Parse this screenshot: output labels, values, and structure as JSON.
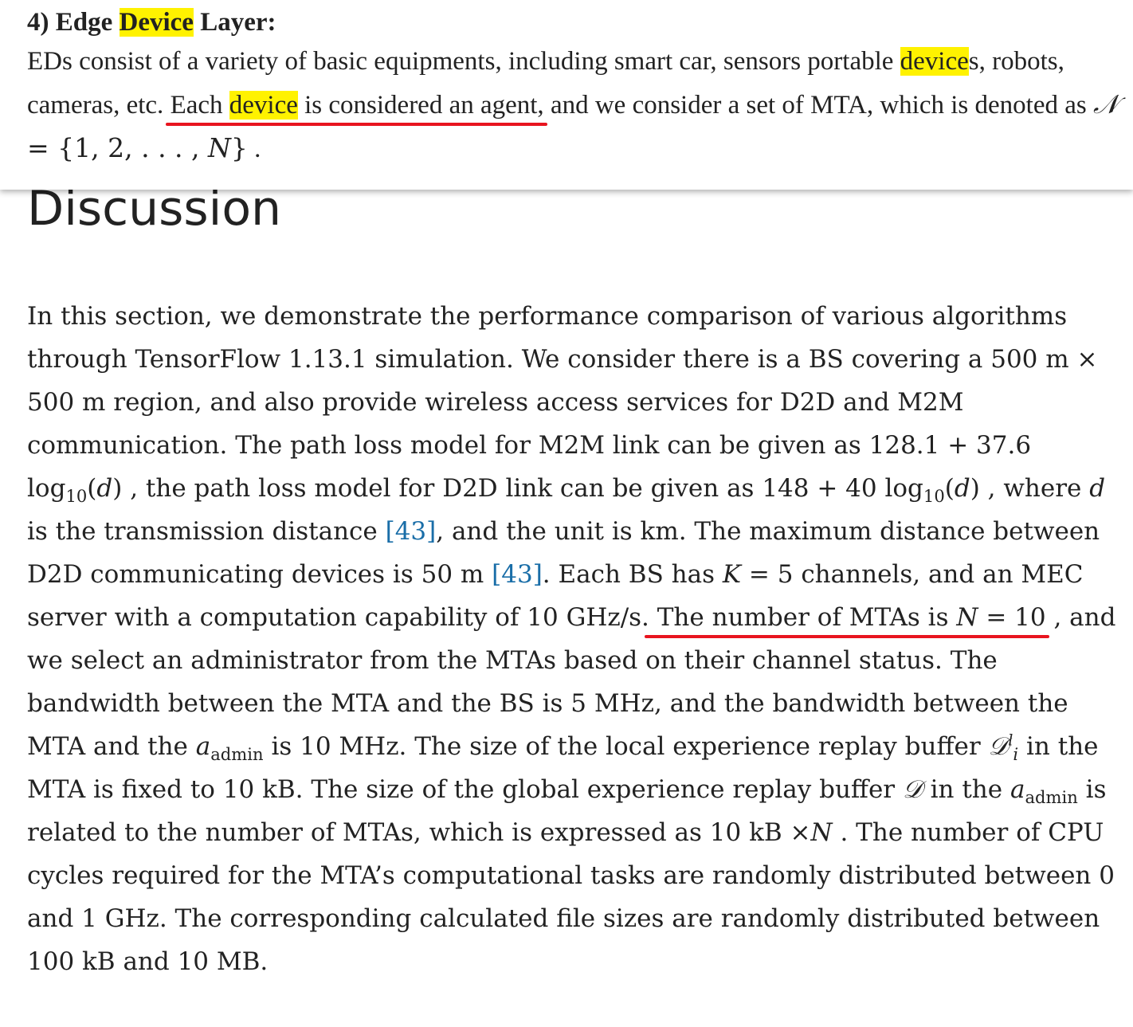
{
  "popup": {
    "title_prefix": "4) Edge ",
    "title_highlight": "Device",
    "title_suffix": " Layer:",
    "body": {
      "s1": "EDs consist of a variety of basic equipments, including smart car, sensors portable ",
      "s2_hl": "device",
      "s3": "s, robots, cameras, etc.",
      "s4_a": "Each ",
      "s4_hl": "device",
      "s4_b": " is considered an agent,",
      "s5": " and we consider a set of MTA, which is denoted as ",
      "s6": "{1, 2, . . . , ",
      "s7": "}",
      "s8": " ."
    }
  },
  "section": {
    "heading": "Discussion",
    "p": {
      "t1": "In this section, we demonstrate the performance comparison of various algorithms through TensorFlow 1.13.1 simulation. We consider there is a BS covering a 500 m ×  500 m region, and also provide wireless access services for D2D and M2M communication. The path loss model for M2M link can be given as ",
      "eq1_a": "128.1 + 37.6 log",
      "eq1_sub": "10",
      "t2": " , the path loss model for D2D link can be given as ",
      "eq2_a": "148 + 40 log",
      "eq2_sub": "10",
      "t3": " , where ",
      "t4": " is the transmission distance ",
      "cite1": "[43]",
      "t5": ", and the unit is km. The maximum distance between D2D communicating devices is 50 m ",
      "cite2": "[43]",
      "t6": ". Each BS has ",
      "eqK": " = 5",
      "t7": " channels, and an MEC server with a computation capability of 10 GHz/s.",
      "u1": " The number of MTAs is ",
      "eqN": " = 10",
      "t8": " , and we select an administrator from the MTAs based on their channel status. The bandwidth between the MTA and the BS is 5 MHz, and the bandwidth between the MTA and the ",
      "admin1": "admin",
      "t9": " is 10 MHz. The size of the local experience replay buffer ",
      "sup_l": "l",
      "sub_i": "i",
      "t10": " in the MTA is fixed to 10 kB. The size of the global experience replay buffer ",
      "t11": " in the ",
      "admin2": "admin",
      "t12": " is related to the number of MTAs, which is expressed as 10 kB ×",
      "t13": " . The number of CPU cycles required for the MTA’s computational tasks are randomly distributed between 0 and 1 GHz. The corresponding calculated file sizes are randomly distributed between 100 kB and 10 MB."
    }
  },
  "colors": {
    "highlight": "#fff200",
    "underline": "#e8141f",
    "citation": "#1a6ea8",
    "text": "#222222"
  }
}
